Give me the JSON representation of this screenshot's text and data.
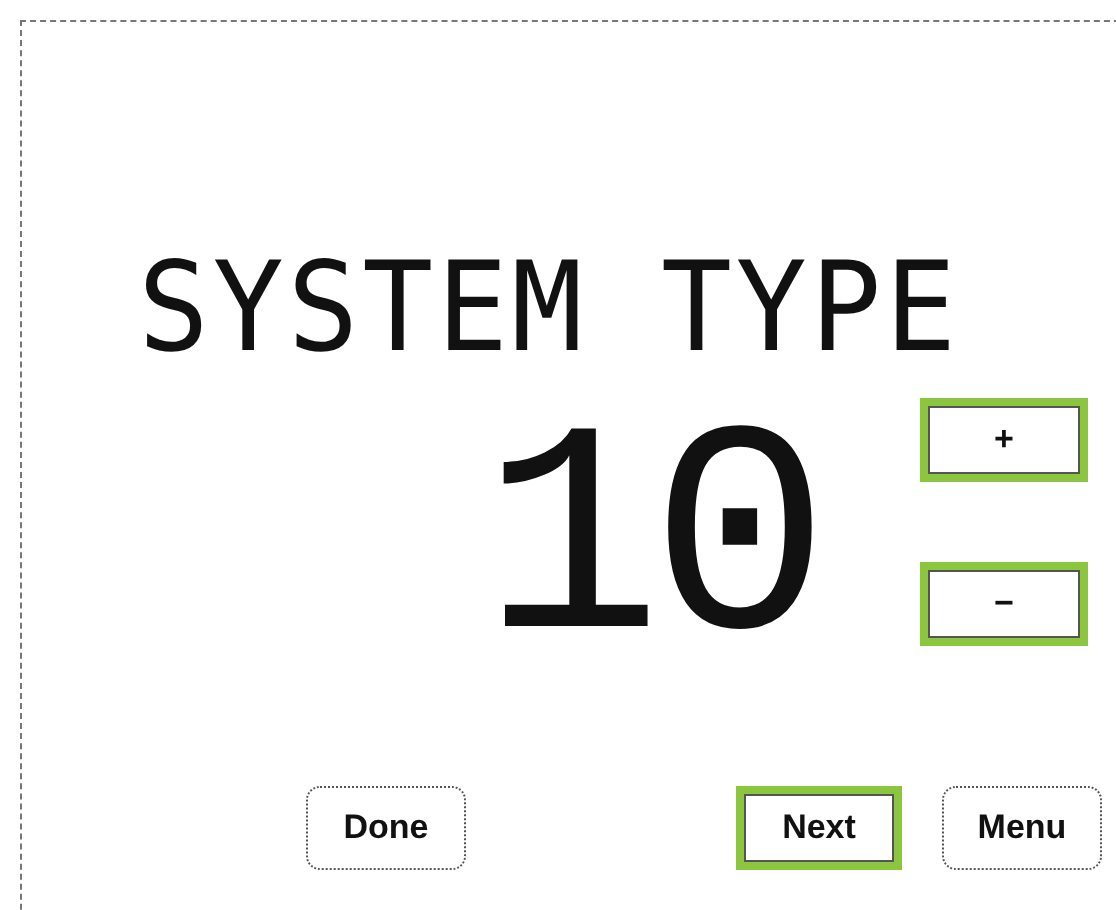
{
  "display": {
    "title": "SYSTEM TYPE",
    "value": "10"
  },
  "adjust_buttons": [
    {
      "label": "+",
      "highlighted": true
    },
    {
      "label": "−",
      "highlighted": true
    }
  ],
  "bottom_buttons": [
    {
      "label": "Done",
      "highlighted": false
    },
    {
      "label": "Next",
      "highlighted": true
    },
    {
      "label": "Menu",
      "highlighted": false
    }
  ]
}
